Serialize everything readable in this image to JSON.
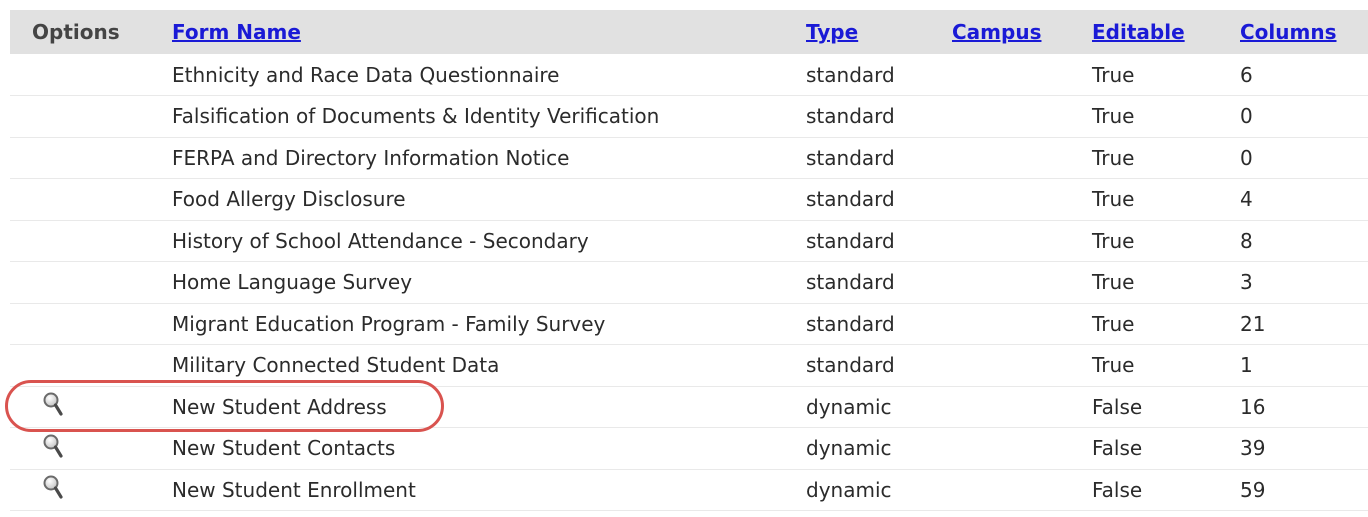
{
  "table": {
    "headers": {
      "options": "Options",
      "form_name": "Form Name",
      "type": "Type",
      "campus": "Campus",
      "editable": "Editable",
      "columns": "Columns"
    },
    "rows": [
      {
        "has_view": false,
        "name": "Ethnicity and Race Data Questionnaire",
        "type": "standard",
        "campus": "",
        "editable": "True",
        "columns": "6"
      },
      {
        "has_view": false,
        "name": "Falsification of Documents & Identity Verification",
        "type": "standard",
        "campus": "",
        "editable": "True",
        "columns": "0"
      },
      {
        "has_view": false,
        "name": "FERPA and Directory Information Notice",
        "type": "standard",
        "campus": "",
        "editable": "True",
        "columns": "0"
      },
      {
        "has_view": false,
        "name": "Food Allergy Disclosure",
        "type": "standard",
        "campus": "",
        "editable": "True",
        "columns": "4"
      },
      {
        "has_view": false,
        "name": "History of School Attendance - Secondary",
        "type": "standard",
        "campus": "",
        "editable": "True",
        "columns": "8"
      },
      {
        "has_view": false,
        "name": "Home Language Survey",
        "type": "standard",
        "campus": "",
        "editable": "True",
        "columns": "3"
      },
      {
        "has_view": false,
        "name": "Migrant Education Program - Family Survey",
        "type": "standard",
        "campus": "",
        "editable": "True",
        "columns": "21"
      },
      {
        "has_view": false,
        "name": "Military Connected Student Data",
        "type": "standard",
        "campus": "",
        "editable": "True",
        "columns": "1"
      },
      {
        "has_view": true,
        "name": "New Student Address",
        "type": "dynamic",
        "campus": "",
        "editable": "False",
        "columns": "16"
      },
      {
        "has_view": true,
        "name": "New Student Contacts",
        "type": "dynamic",
        "campus": "",
        "editable": "False",
        "columns": "39"
      },
      {
        "has_view": true,
        "name": "New Student Enrollment",
        "type": "dynamic",
        "campus": "",
        "editable": "False",
        "columns": "59"
      }
    ]
  },
  "icons": {
    "view": "magnifier-icon"
  },
  "colors": {
    "header_bg": "#e1e1e1",
    "link": "#1a1ad6",
    "highlight": "#d9534f"
  }
}
